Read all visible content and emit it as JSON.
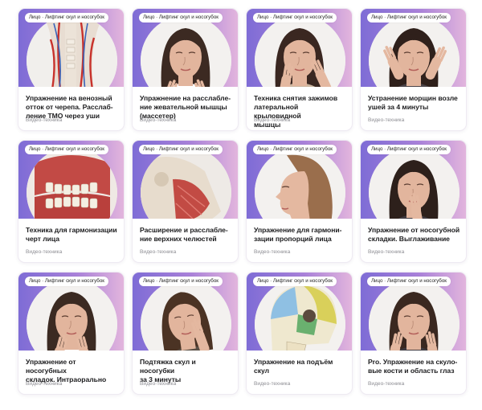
{
  "cards": [
    {
      "tag": "Лицо · Лифтинг скул и носогубок",
      "title_lines": [
        "Упражнение на венозный",
        "отток от черепа. Расслаб-",
        "ление ТМО через уши"
      ],
      "meta": "Видео-техника",
      "image": "anatomy-neck-veins"
    },
    {
      "tag": "Лицо · Лифтинг скул и носогубок",
      "title_lines": [
        "Упражнение на расслабле-",
        "ние жевательной мышцы",
        "(массетер)"
      ],
      "meta": "Видео-техника",
      "image": "woman-jaw-massage"
    },
    {
      "tag": "Лицо · Лифтинг скул и носогубок",
      "title_lines": [
        "Техника снятия зажимов",
        "латеральной крыловидной",
        "мышцы"
      ],
      "meta": "Видео-техника",
      "image": "woman-cheek-touch"
    },
    {
      "tag": "Лицо · Лифтинг скул и носогубок",
      "title_lines": [
        "Устранение морщин возле",
        "ушей за 4 минуты"
      ],
      "meta": "Видео-техника",
      "image": "woman-ears-touch"
    },
    {
      "tag": "Лицо · Лифтинг скул и носогубок",
      "title_lines": [
        "Техника для гармонизации",
        "черт лица"
      ],
      "meta": "Видео-техника",
      "image": "anatomy-teeth-jaw"
    },
    {
      "tag": "Лицо · Лифтинг скул и носогубок",
      "title_lines": [
        "Расширение и расслабле-",
        "ние верхних челюстей"
      ],
      "meta": "Видео-техника",
      "image": "anatomy-jaw-muscles"
    },
    {
      "tag": "Лицо · Лифтинг скул и носогубок",
      "title_lines": [
        "Упражнение для гармони-",
        "зации пропорций лица"
      ],
      "meta": "Видео-техника",
      "image": "woman-profile"
    },
    {
      "tag": "Лицо · Лифтинг скул и носогубок",
      "title_lines": [
        "Упражнение от носогубной",
        "складки. Выглаживание"
      ],
      "meta": "Видео-техника",
      "image": "woman-nose-touch"
    },
    {
      "tag": "Лицо · Лифтинг скул и носогубок",
      "title_lines": [
        "Упражнение от носогубных",
        "складок. Интраорально"
      ],
      "meta": "Видео-техника",
      "image": "woman-mouth-fingers"
    },
    {
      "tag": "Лицо · Лифтинг скул и носогубок",
      "title_lines": [
        "Подтяжка скул и носогубки",
        "за 3 минуты"
      ],
      "meta": "Видео-техника",
      "image": "woman-cheekbone-press"
    },
    {
      "tag": "Лицо · Лифтинг скул и носогубок",
      "title_lines": [
        "Упражнение на подъём",
        "скул"
      ],
      "meta": "Видео-техника",
      "image": "anatomy-skull"
    },
    {
      "tag": "Лицо · Лифтинг скул и носогубок",
      "title_lines": [
        "Pro. Упражнение на скуло-",
        "вые кости и область глаз"
      ],
      "meta": "Видео-техника",
      "image": "woman-face-hands"
    }
  ],
  "colors": {
    "banner_start": "#7e6cd6",
    "banner_end": "#e2b5dd",
    "title": "#1d1d1f",
    "meta": "#8d8d93"
  }
}
